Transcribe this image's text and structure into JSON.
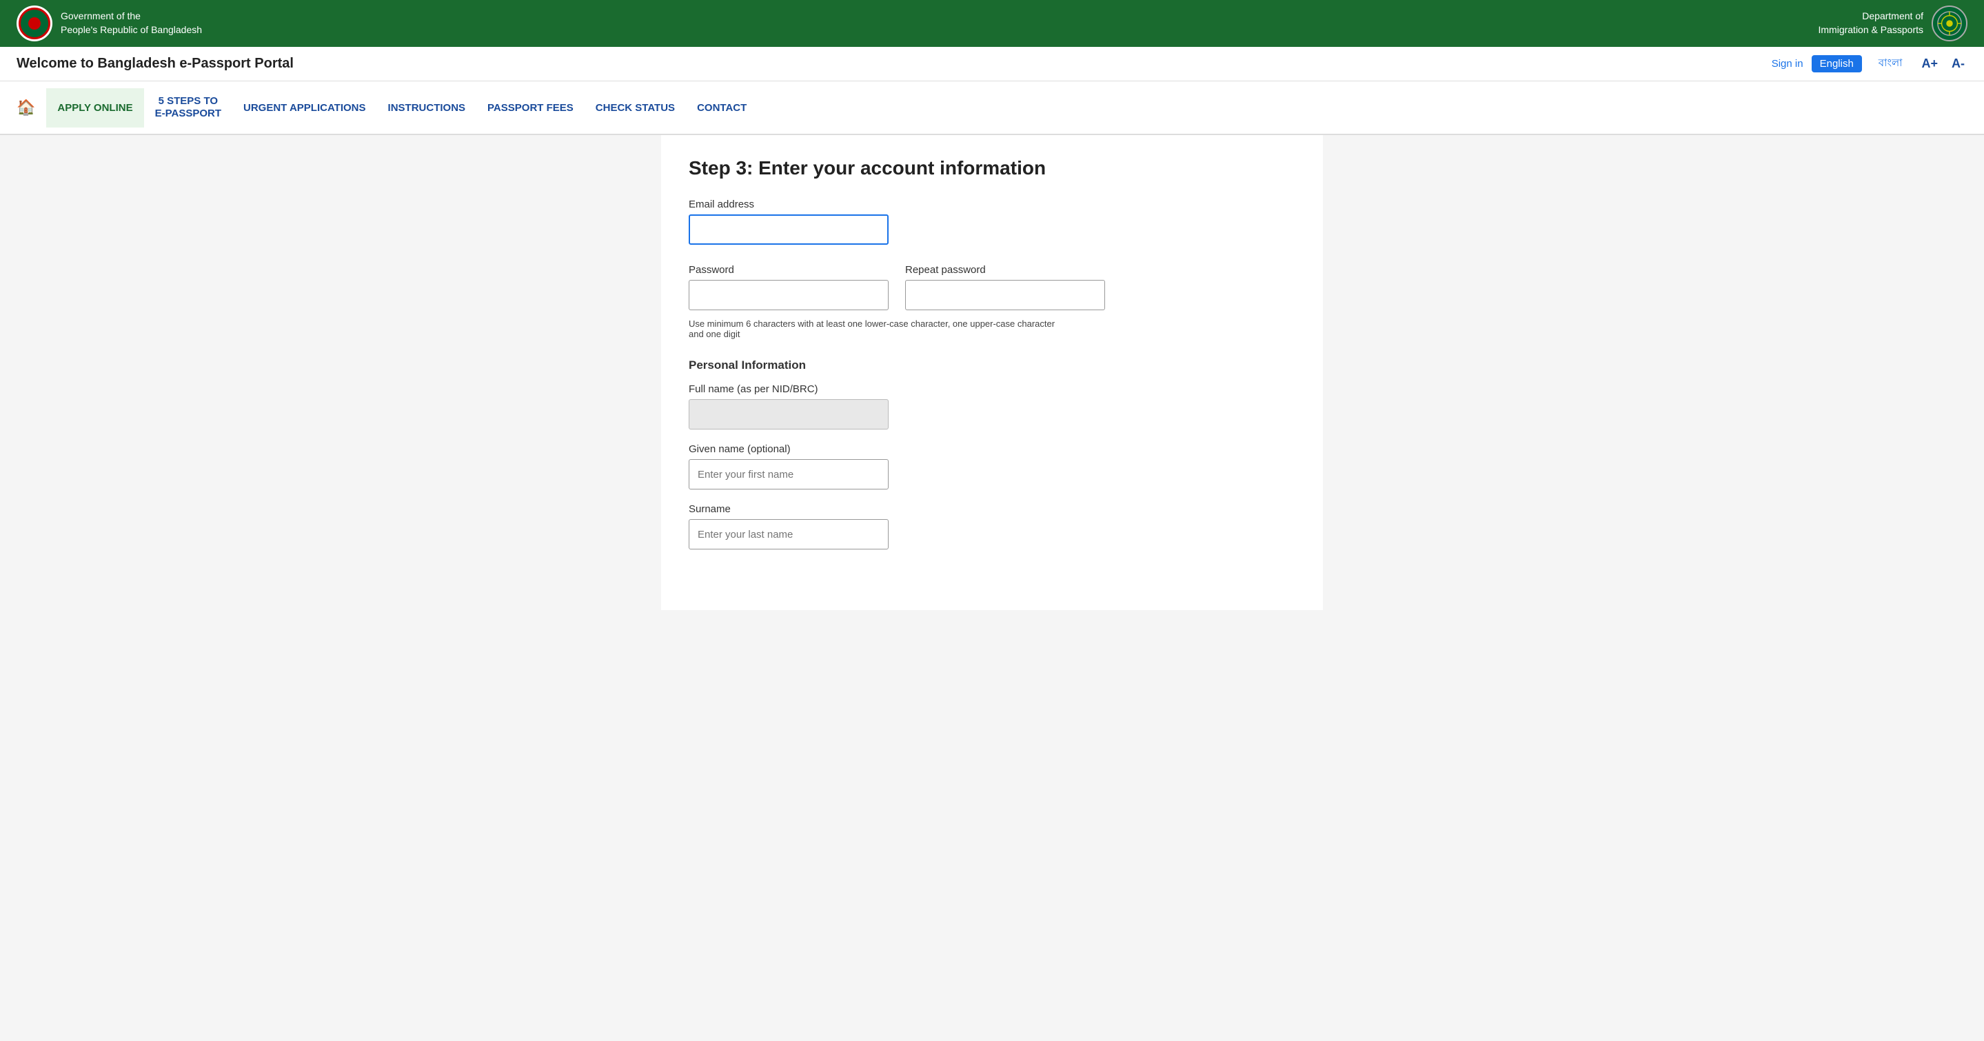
{
  "top_header": {
    "gov_line1": "Government of the",
    "gov_line2": "People's Republic of Bangladesh",
    "dept_line1": "Department of",
    "dept_line2": "Immigration & Passports"
  },
  "nav_bar": {
    "title": "Welcome to Bangladesh e-Passport Portal",
    "sign_in": "Sign in",
    "lang_english": "English",
    "lang_bangla": "বাংলা",
    "font_increase": "A+",
    "font_decrease": "A-"
  },
  "main_nav": {
    "home_icon": "🏠",
    "items": [
      {
        "label": "APPLY ONLINE",
        "active": true
      },
      {
        "label": "5 STEPS TO\ne-PASSPORT",
        "active": false
      },
      {
        "label": "URGENT APPLICATIONS",
        "active": false
      },
      {
        "label": "INSTRUCTIONS",
        "active": false
      },
      {
        "label": "PASSPORT FEES",
        "active": false
      },
      {
        "label": "CHECK STATUS",
        "active": false
      },
      {
        "label": "CONTACT",
        "active": false
      }
    ]
  },
  "form": {
    "page_title": "Step 3: Enter your account information",
    "email_label": "Email address",
    "email_placeholder": "",
    "email_value": "",
    "password_label": "Password",
    "password_placeholder": "",
    "repeat_password_label": "Repeat password",
    "repeat_password_placeholder": "",
    "password_hint": "Use minimum 6 characters with at least one lower-case character, one upper-case character and one digit",
    "personal_info_label": "Personal Information",
    "full_name_label": "Full name (as per NID/BRC)",
    "full_name_value": "",
    "given_name_label": "Given name (optional)",
    "given_name_placeholder": "Enter your first name",
    "surname_label": "Surname",
    "surname_placeholder": "Enter your last name"
  }
}
